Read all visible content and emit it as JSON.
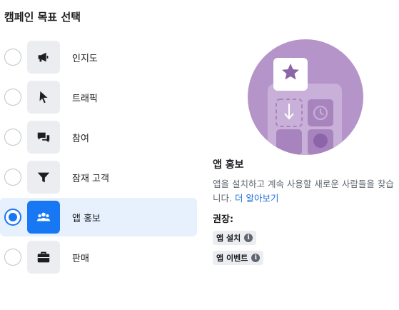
{
  "panel": {
    "title": "캠페인 목표 선택"
  },
  "objectives": [
    {
      "label": "인지도",
      "icon": "megaphone-icon",
      "selected": false
    },
    {
      "label": "트래픽",
      "icon": "cursor-icon",
      "selected": false
    },
    {
      "label": "참여",
      "icon": "chat-bubbles-icon",
      "selected": false
    },
    {
      "label": "잠재 고객",
      "icon": "funnel-icon",
      "selected": false
    },
    {
      "label": "앱 홍보",
      "icon": "people-group-icon",
      "selected": true
    },
    {
      "label": "판매",
      "icon": "briefcase-icon",
      "selected": false
    }
  ],
  "detail": {
    "title": "앱 홍보",
    "description": "앱을 설치하고 계속 사용할 새로운 사람들을 찾습니다.",
    "learn_more": "더 알아보기",
    "recommended_label": "권장:",
    "tags": [
      "앱 설치",
      "앱 이벤트"
    ]
  },
  "colors": {
    "accent": "#1877f2",
    "selected_row_bg": "#e7f0fd",
    "illustration_purple": "#b494c9"
  }
}
